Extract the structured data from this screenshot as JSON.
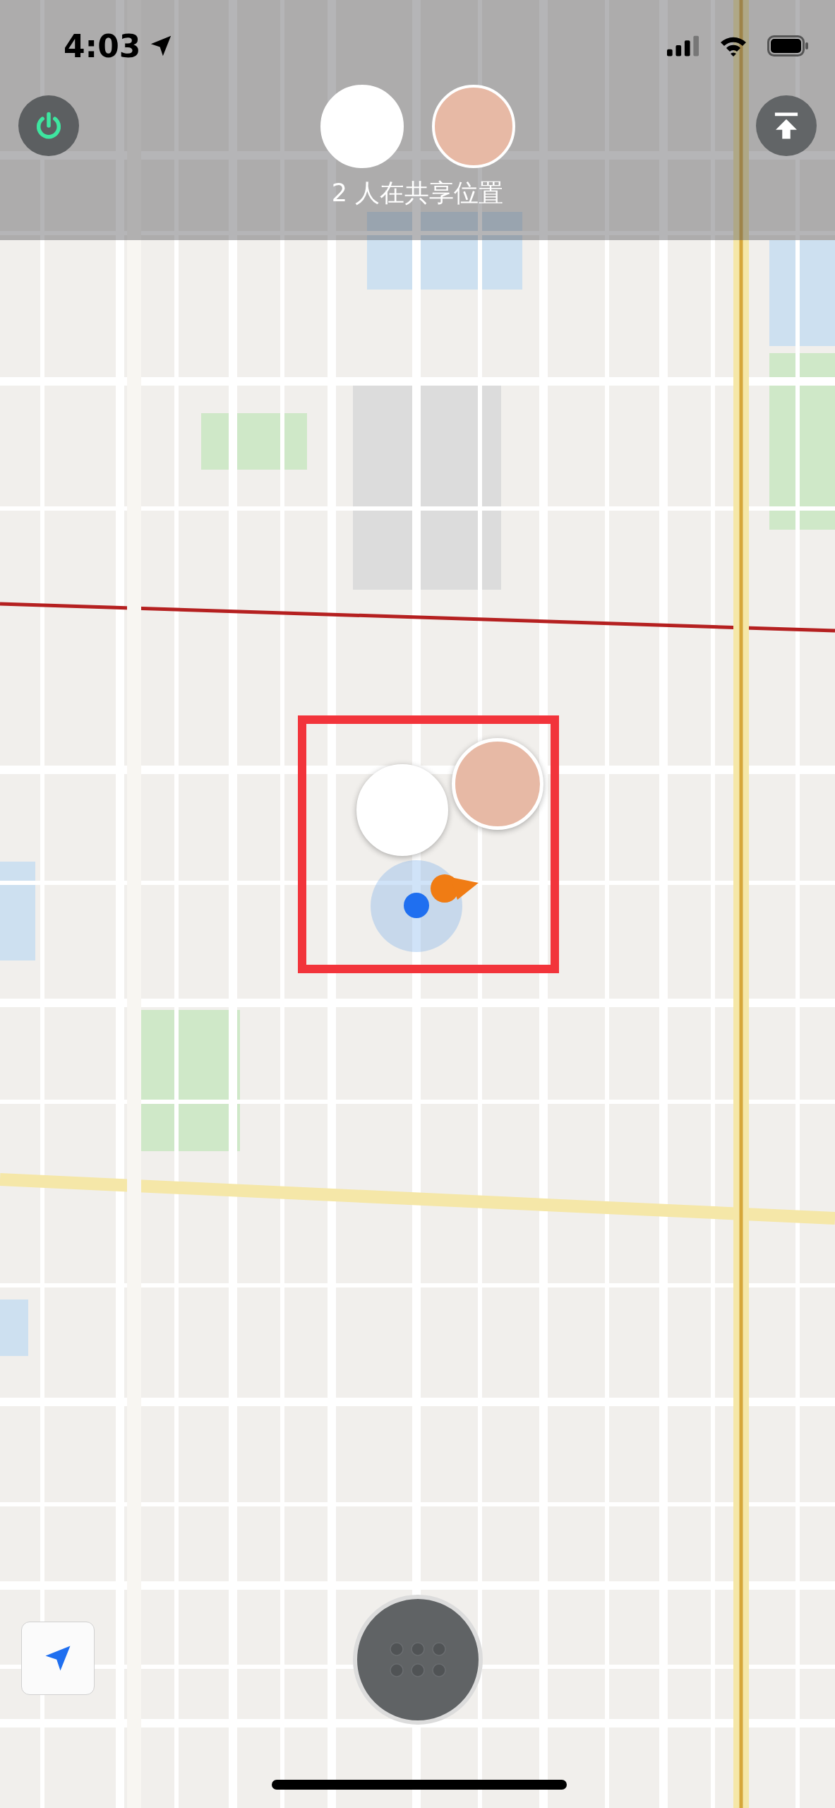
{
  "status_bar": {
    "time": "4:03"
  },
  "share_bar": {
    "avatars": [
      {
        "kind": "logo"
      },
      {
        "kind": "photo"
      }
    ],
    "caption": "2 人在共享位置"
  },
  "map": {
    "highlighted": true,
    "pins": [
      {
        "kind": "photo"
      },
      {
        "kind": "logo"
      }
    ]
  }
}
